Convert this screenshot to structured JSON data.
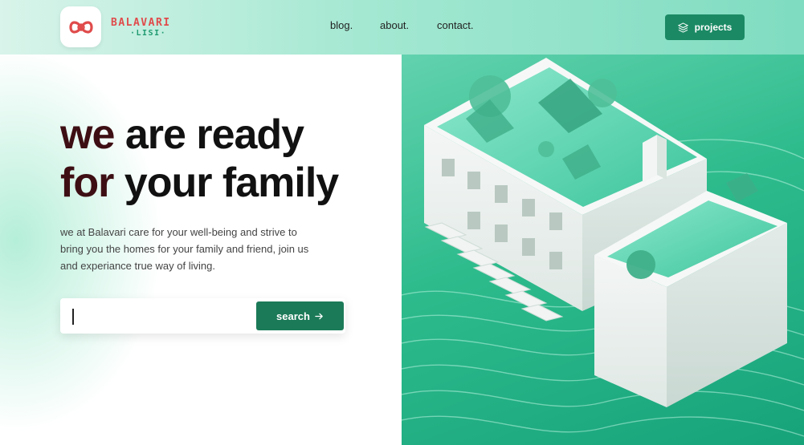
{
  "brand": {
    "name": "BALAVARI",
    "sub": "·LISI·",
    "logo_icon": "infinity-knot-icon",
    "colors": {
      "primary": "#1b8a64",
      "logo_red": "#e04b4b",
      "accent_dark": "#3d0f14"
    }
  },
  "nav": {
    "blog": "blog.",
    "about": "about.",
    "contact": "contact."
  },
  "projects_button": {
    "label": "projects",
    "icon": "layers-icon"
  },
  "hero": {
    "title_line1_accent": "we",
    "title_line1_rest": " are ready",
    "title_line2_accent": "for",
    "title_line2_rest": " your family",
    "description": "we at Balavari care for your well-being and strive to bring you the homes for your family and friend, join us and experiance true way of living."
  },
  "search": {
    "value": "",
    "placeholder": "",
    "button_label": "search",
    "button_icon": "arrow-right-icon"
  },
  "image": {
    "name": "building-illustration"
  }
}
